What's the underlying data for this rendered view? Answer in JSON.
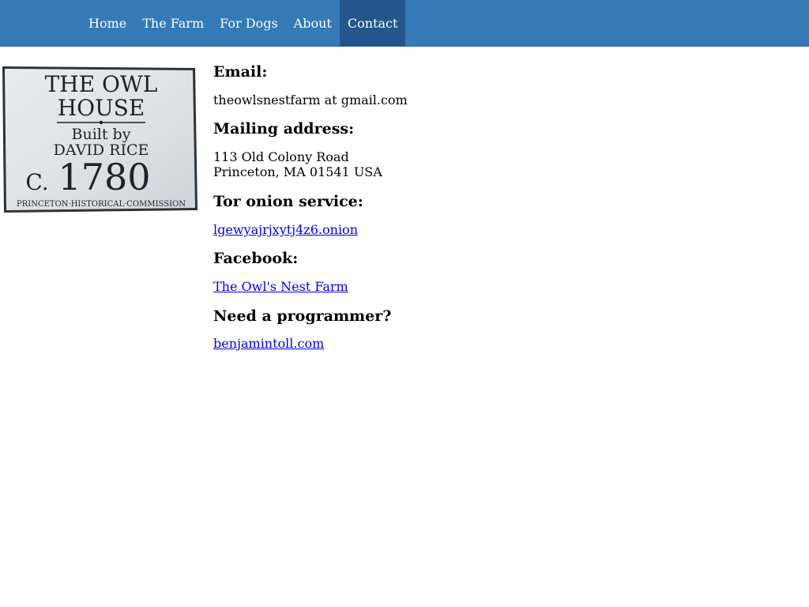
{
  "nav": {
    "items": [
      {
        "label": "Home",
        "active": false
      },
      {
        "label": "The Farm",
        "active": false
      },
      {
        "label": "For Dogs",
        "active": false
      },
      {
        "label": "About",
        "active": false
      },
      {
        "label": "Contact",
        "active": true
      }
    ]
  },
  "colors": {
    "navbar_bg": "#337ab7",
    "nav_active_bg": "#23568a",
    "link": "#0000ee"
  },
  "sign": {
    "line1": "THE OWL",
    "line2": "HOUSE",
    "line3": "Built  by",
    "line4": "DAVID  RICE",
    "prefix": "C.",
    "year": "1780",
    "footer": "PRINCETON·HISTORICAL·COMMISSION"
  },
  "contact": {
    "email_heading": "Email:",
    "email_value": "theowlsnestfarm at gmail.com",
    "mailing_heading": "Mailing address:",
    "address_line1": "113 Old Colony Road",
    "address_line2": "Princeton, MA 01541 USA",
    "tor_heading": "Tor onion service:",
    "tor_link": "lgewyajrjxytj4z6.onion",
    "facebook_heading": "Facebook:",
    "facebook_link": "The Owl's Nest Farm",
    "programmer_heading": "Need a programmer?",
    "programmer_link": "benjamintoll.com"
  }
}
